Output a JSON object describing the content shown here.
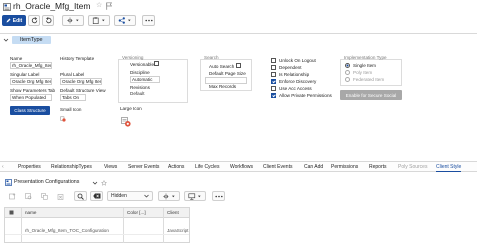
{
  "window": {
    "title": "rh_Oracle_Mfg_Item",
    "star_glyph": "☆"
  },
  "toolbar": {
    "edit_label": "Edit"
  },
  "item_type_section": {
    "tab_label": "ItemType",
    "name_label": "Name",
    "name_value": "rh_Oracle_Mfg_Item",
    "singular_label_label": "Singular Label",
    "singular_label_value": "Oracle Org Mfg Item",
    "show_params_label": "Show Parameters Tab",
    "show_params_value": "When Populated",
    "class_structure_button": "Class Structure",
    "history_template_label": "History Template",
    "plural_label_label": "Plural Label",
    "plural_label_value": "Oracle Org Mfg Item",
    "default_structure_view_label": "Default Structure View",
    "default_structure_view_value": "Tabs On",
    "small_icon_label": "Small Icon",
    "large_icon_label": "Large Icon",
    "versioning": {
      "title": "Versioning",
      "versionable_label": "Versionable",
      "versionable_checked": false,
      "discipline_label": "Discipline",
      "discipline_value": "Automatic",
      "revisions_label": "Revisions",
      "revisions_value": "Default"
    },
    "search": {
      "title": "Search",
      "auto_search_label": "Auto Search",
      "auto_search_checked": false,
      "default_page_size_label": "Default Page Size",
      "max_records_label": "Max Records"
    },
    "options": [
      {
        "label": "Unlock On Logout",
        "checked": false
      },
      {
        "label": "Dependent",
        "checked": false
      },
      {
        "label": "Is Relationship",
        "checked": false
      },
      {
        "label": "Enforce Discovery",
        "checked": true
      },
      {
        "label": "Use Acc Access",
        "checked": false
      },
      {
        "label": "Allow Private Permissions",
        "checked": true
      }
    ],
    "implementation": {
      "title": "Implementation Type",
      "options": [
        {
          "label": "Single Item",
          "selected": true
        },
        {
          "label": "Poly Item",
          "selected": false
        },
        {
          "label": "Federated Item",
          "selected": false
        }
      ],
      "secure_social_button": "Enable for Secure Social"
    }
  },
  "relationship_tabs": [
    {
      "label": "Properties",
      "state": "normal"
    },
    {
      "label": "RelationshipTypes",
      "state": "normal"
    },
    {
      "label": "Views",
      "state": "normal"
    },
    {
      "label": "Server Events",
      "state": "normal"
    },
    {
      "label": "Actions",
      "state": "normal"
    },
    {
      "label": "Life Cycles",
      "state": "normal"
    },
    {
      "label": "Workflows",
      "state": "normal"
    },
    {
      "label": "Client Events",
      "state": "normal"
    },
    {
      "label": "Can Add",
      "state": "normal"
    },
    {
      "label": "Permissions",
      "state": "normal"
    },
    {
      "label": "Reports",
      "state": "normal"
    },
    {
      "label": "Poly Sources",
      "state": "disabled"
    },
    {
      "label": "Client Style",
      "state": "active"
    }
  ],
  "presentation_panel": {
    "title": "Presentation Configurations",
    "hidden_select_value": "Hidden",
    "columns": [
      "name",
      "Color [...]",
      "Client"
    ],
    "rows": [
      {
        "name": "rh_Oracle_Mfg_Item_TOC_Configuration",
        "color": "",
        "client": "JavaScript"
      }
    ]
  },
  "colors": {
    "accent": "#1a4ea0",
    "section_tab": "#c5dcf3",
    "disabled_button": "#a8a8a8"
  }
}
